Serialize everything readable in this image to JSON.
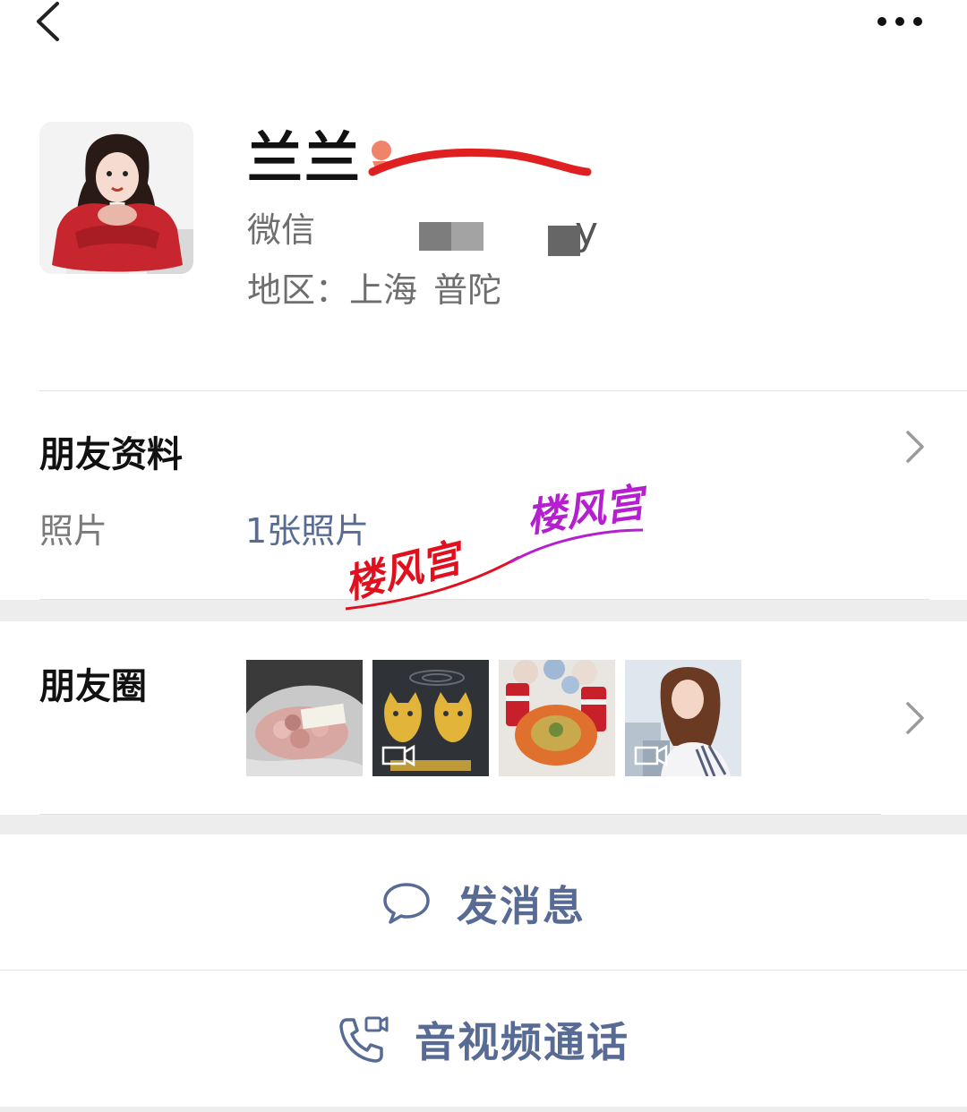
{
  "header": {
    "back_icon": "chevron-left-icon",
    "more_icon": "more-dots-icon"
  },
  "profile": {
    "name": "兰兰",
    "wechat_label": "微信",
    "wechat_id_tail": "y",
    "region": "地区：上海 普陀"
  },
  "friend_info": {
    "title": "朋友资料",
    "photo_label": "照片",
    "photo_value": "1张照片"
  },
  "moments": {
    "title": "朋友圈",
    "thumbnails": [
      {
        "subject": "rose bouquet",
        "has_video": false
      },
      {
        "subject": "cats drawn on ground",
        "has_video": true
      },
      {
        "subject": "coca-cola and food",
        "has_video": false
      },
      {
        "subject": "anime girl by window",
        "has_video": true
      }
    ]
  },
  "actions": {
    "message_label": "发消息",
    "message_icon": "chat-bubble-icon",
    "call_label": "音视频通话",
    "call_icon": "phone-video-icon"
  },
  "watermarks": [
    "楼风宫",
    "楼风宫"
  ],
  "colors": {
    "link_blue": "#576b95",
    "gap_gray": "#ededed",
    "scribble_red": "#e02020"
  }
}
